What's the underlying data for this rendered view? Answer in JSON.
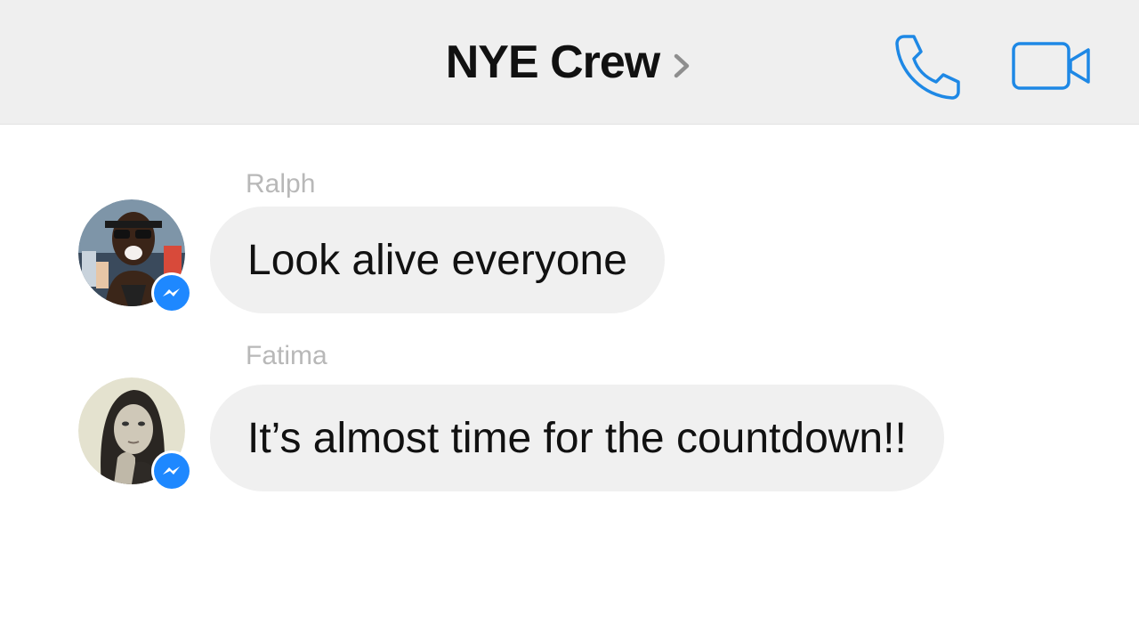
{
  "header": {
    "title": "NYE Crew",
    "chevron_icon": "chevron-right-icon",
    "call_icon": "phone-icon",
    "video_icon": "video-camera-icon",
    "accent_color": "#1e88e5"
  },
  "messages": [
    {
      "sender": "Ralph",
      "text": "Look alive everyone",
      "avatar": "avatar-photo",
      "badge_icon": "messenger-icon"
    },
    {
      "sender": "Fatima",
      "text": "It’s almost time for the countdown!!",
      "avatar": "avatar-photo",
      "badge_icon": "messenger-icon"
    }
  ],
  "colors": {
    "header_bg": "#efefef",
    "bubble_bg": "#f0f0f0",
    "sender_name": "#b8b8b8",
    "messenger_blue": "#1e88ff"
  }
}
